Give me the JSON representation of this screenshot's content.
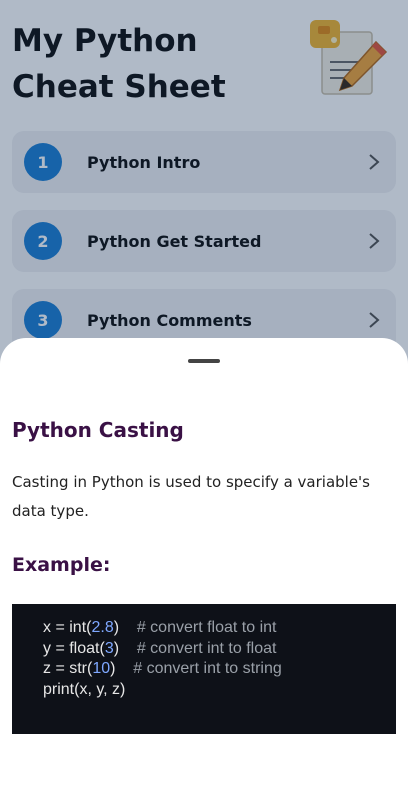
{
  "app": {
    "title": "My Python Cheat Sheet",
    "topics": [
      {
        "number": "1",
        "label": "Python Intro"
      },
      {
        "number": "2",
        "label": "Python Get Started"
      },
      {
        "number": "3",
        "label": "Python Comments"
      }
    ]
  },
  "sheet": {
    "title": "Python Casting",
    "description": "Casting in Python is used to specify a variable's data type.",
    "example_heading": "Example:",
    "code": {
      "line1": {
        "pre": "x = int(",
        "num": "2.8",
        "post": ")    ",
        "comment": "# convert float to int"
      },
      "line2": {
        "pre": "y = float(",
        "num": "3",
        "post": ")    ",
        "comment": "# convert int to float"
      },
      "line3": {
        "pre": "z = str(",
        "num": "10",
        "post": ")    ",
        "comment": "# convert int to string"
      },
      "line4": {
        "text": "print(x, y, z)"
      }
    }
  },
  "colors": {
    "accent_badge": "#1e7fd3",
    "heading_purple": "#3a1145",
    "code_bg": "#0e1118",
    "scrim": "#0a2850"
  },
  "icons": {
    "logo": "python-notes-logo-icon",
    "chevron": "chevron-right-icon"
  }
}
